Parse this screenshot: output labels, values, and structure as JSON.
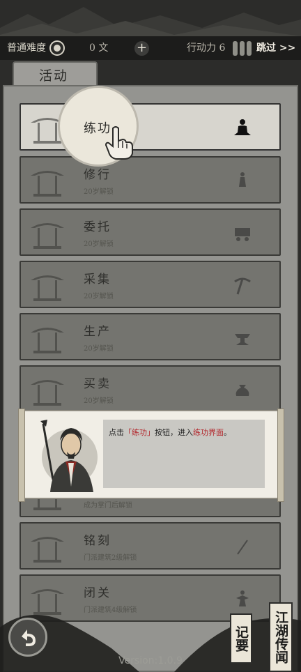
{
  "topbar": {
    "difficulty": "普通难度",
    "coins": "0 文",
    "plus": "+",
    "action_label": "行动力 6",
    "skip": "跳过 >>"
  },
  "tab": {
    "label": "活动"
  },
  "rows": [
    {
      "name": "练功",
      "sub": "",
      "icon": "meditation-icon"
    },
    {
      "name": "修行",
      "sub": "20岁解锁",
      "icon": "monk-icon"
    },
    {
      "name": "委托",
      "sub": "20岁解锁",
      "icon": "cart-icon"
    },
    {
      "name": "采集",
      "sub": "20岁解锁",
      "icon": "pickaxe-icon"
    },
    {
      "name": "生产",
      "sub": "20岁解锁",
      "icon": "anvil-icon"
    },
    {
      "name": "买卖",
      "sub": "20岁解锁",
      "icon": "coin-bag-icon"
    },
    {
      "name": "",
      "sub": "成为掌门后解锁",
      "icon": ""
    },
    {
      "name": "铭刻",
      "sub": "门派建筑2级解锁",
      "icon": "chisel-icon"
    },
    {
      "name": "闭关",
      "sub": "门派建筑4级解锁",
      "icon": "figure-icon"
    }
  ],
  "spotlight": {
    "label": "练功"
  },
  "dialog": {
    "pre": "点击",
    "hl1": "「练功」",
    "mid": "按钮，进入",
    "hl2": "练功界面",
    "post": "。"
  },
  "bottom": {
    "version": "Version:1.0.9",
    "jiyao": "记要",
    "jianghu": "江湖传闻"
  },
  "colors": {
    "highlight": "#b3262b",
    "panel": "#949490",
    "topbar": "#1c1c1b"
  }
}
